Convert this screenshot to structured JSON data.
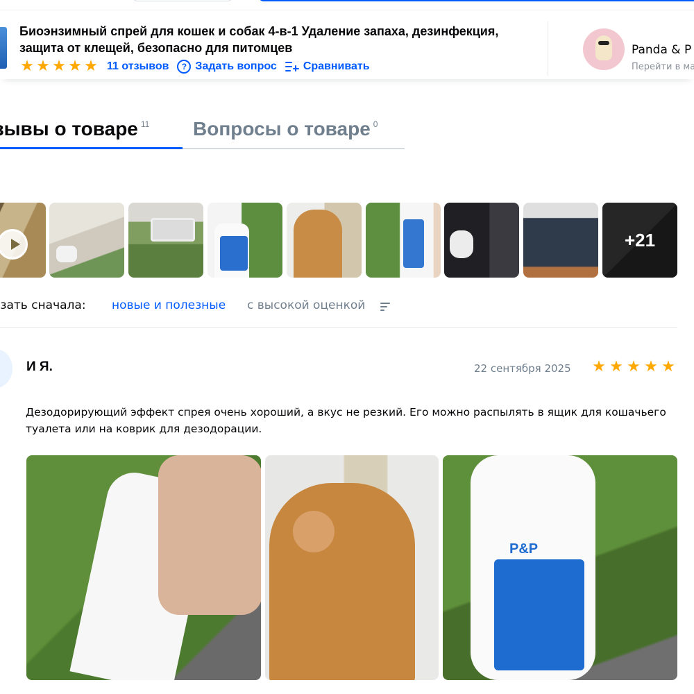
{
  "product": {
    "title": "Биоэнзимный спрей для кошек и собак 4-в-1 Удаление запаха, дезинфекция, защита от клещей, безопасно для питомцев",
    "rating_stars": 5,
    "reviews_link": "11 отзывов",
    "ask_question": "Задать вопрос",
    "compare": "Сравнивать"
  },
  "seller": {
    "name": "Panda & P",
    "subtitle": "Перейти в ма"
  },
  "tabs": [
    {
      "label": "тзывы о товаре",
      "count": "11",
      "active": true
    },
    {
      "label": "Вопросы о товаре",
      "count": "0",
      "active": false
    }
  ],
  "gallery": {
    "more_label": "+21"
  },
  "sort": {
    "label": "азать сначала:",
    "option_active": "новые и полезные",
    "option_other": "с высокой оценкой"
  },
  "review": {
    "author": "И Я.",
    "date": "22 сентября 2025",
    "rating_stars": 5,
    "text": "Дезодорирующий эффект спрея очень хороший, а вкус не резкий. Его можно распылять в ящик для кошачьего туалета или на коврик для дезодорации."
  },
  "colors": {
    "accent": "#005bff",
    "star": "#ffa800",
    "muted": "#707f8d"
  },
  "icons": {
    "star": "star-icon",
    "question": "question-icon",
    "compare": "compare-icon",
    "sort": "sort-icon",
    "play": "play-icon"
  }
}
